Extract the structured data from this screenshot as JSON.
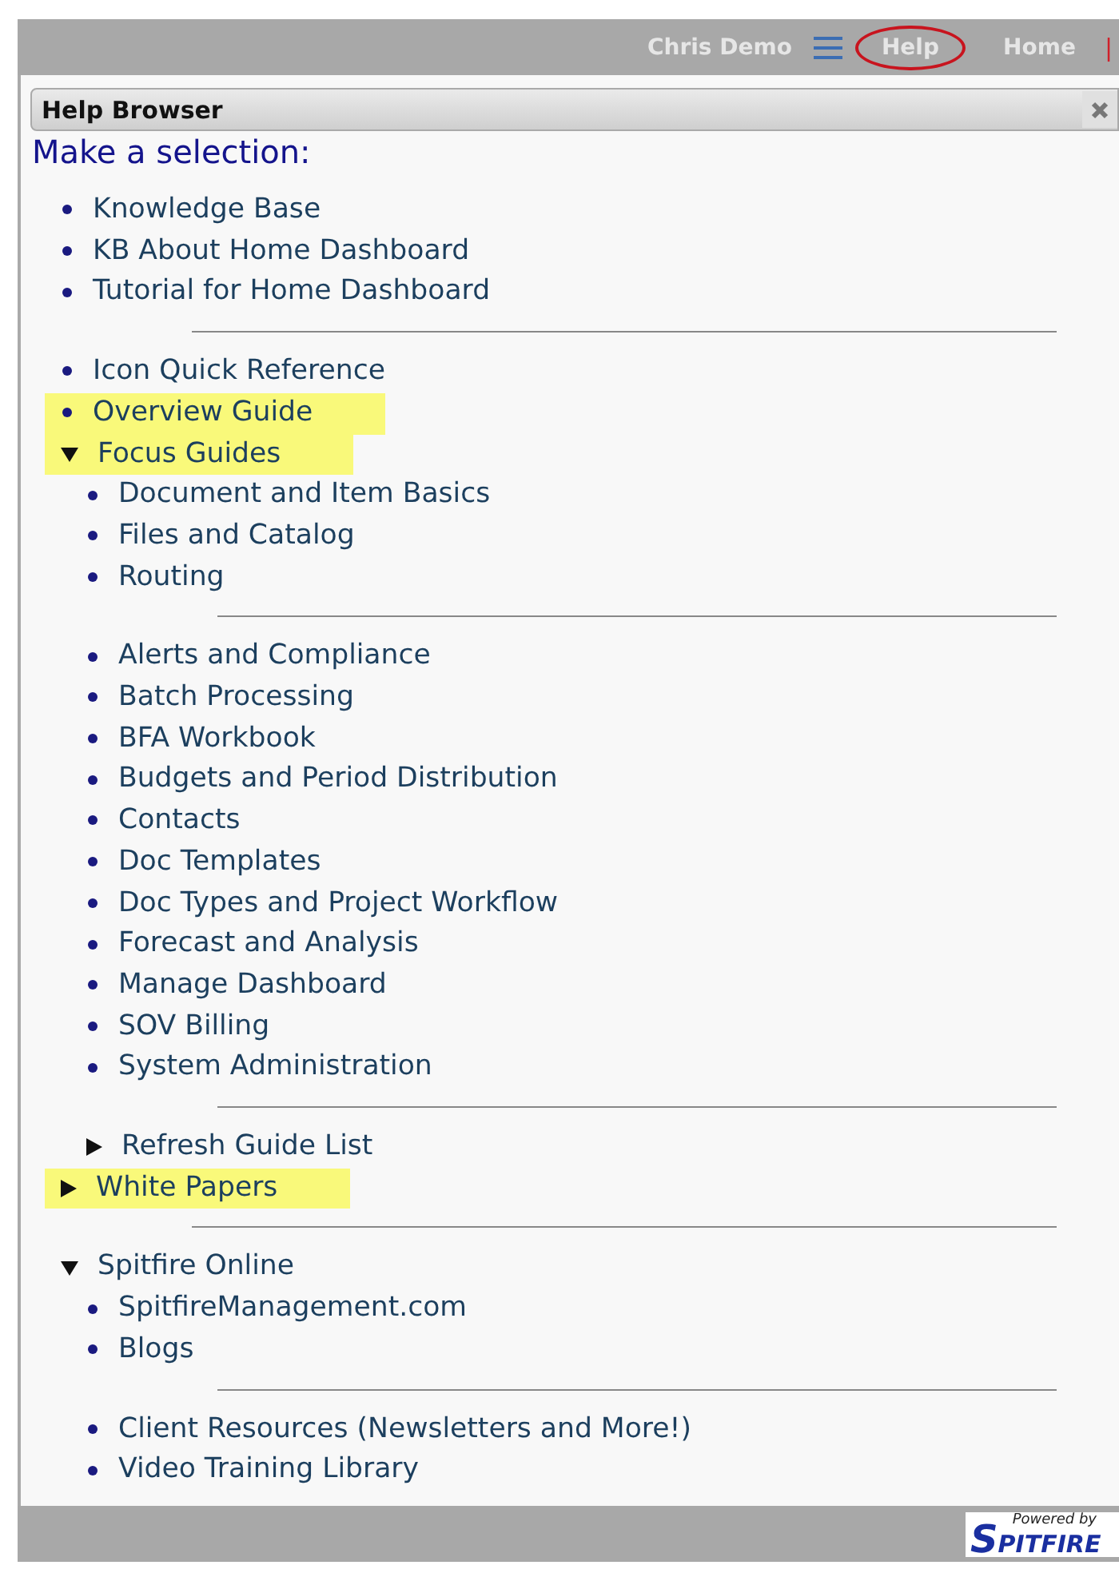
{
  "top_bar": {
    "user": "Chris Demo",
    "links": [
      {
        "label": "Help",
        "circled": true
      },
      {
        "label": "Home",
        "circled": false
      }
    ],
    "end_mark": "|"
  },
  "panel": {
    "title": "Help Browser",
    "heading": "Make a selection:"
  },
  "items": [
    {
      "kind": "link",
      "label": "Knowledge Base",
      "highlighted": false
    },
    {
      "kind": "link",
      "label": "KB About Home Dashboard",
      "highlighted": false
    },
    {
      "kind": "link",
      "label": "Tutorial for Home Dashboard",
      "highlighted": false
    },
    {
      "kind": "divider"
    },
    {
      "kind": "link",
      "label": "Icon Quick Reference",
      "highlighted": false
    },
    {
      "kind": "link",
      "label": "Overview Guide",
      "highlighted": true
    },
    {
      "kind": "folder",
      "label": "Focus Guides",
      "highlighted": true,
      "expanded": true,
      "children": [
        {
          "kind": "link",
          "label": "Document and Item Basics",
          "highlighted": false
        },
        {
          "kind": "link",
          "label": "Files and Catalog",
          "highlighted": false
        },
        {
          "kind": "link",
          "label": "Routing",
          "highlighted": false
        },
        {
          "kind": "divider"
        },
        {
          "kind": "link",
          "label": "Alerts and Compliance",
          "highlighted": false
        },
        {
          "kind": "link",
          "label": "Batch Processing",
          "highlighted": false
        },
        {
          "kind": "link",
          "label": "BFA Workbook",
          "highlighted": false
        },
        {
          "kind": "link",
          "label": "Budgets and Period Distribution",
          "highlighted": false
        },
        {
          "kind": "link",
          "label": "Contacts",
          "highlighted": false
        },
        {
          "kind": "link",
          "label": "Doc Templates",
          "highlighted": false
        },
        {
          "kind": "link",
          "label": "Doc Types and Project Workflow",
          "highlighted": false
        },
        {
          "kind": "link",
          "label": "Forecast and Analysis",
          "highlighted": false
        },
        {
          "kind": "link",
          "label": "Manage Dashboard",
          "highlighted": false
        },
        {
          "kind": "link",
          "label": "SOV Billing",
          "highlighted": false
        },
        {
          "kind": "link",
          "label": "System Administration",
          "highlighted": false
        },
        {
          "kind": "divider"
        },
        {
          "kind": "folder",
          "label": "Refresh Guide List",
          "highlighted": false,
          "expanded": false
        }
      ]
    },
    {
      "kind": "folder",
      "label": "White Papers",
      "highlighted": true,
      "expanded": false
    },
    {
      "kind": "divider"
    },
    {
      "kind": "folder",
      "label": "Spitfire Online",
      "highlighted": false,
      "expanded": true,
      "children": [
        {
          "kind": "link",
          "label": "SpitfireManagement.com",
          "highlighted": false
        },
        {
          "kind": "link",
          "label": "Blogs",
          "highlighted": false
        },
        {
          "kind": "divider"
        },
        {
          "kind": "link",
          "label": "Client Resources (Newsletters and More!)",
          "highlighted": false
        },
        {
          "kind": "link",
          "label": "Video Training Library",
          "highlighted": false
        }
      ]
    }
  ],
  "footer": {
    "logo": {
      "tagline": "Powered by",
      "name": "SPITFIRE"
    }
  }
}
